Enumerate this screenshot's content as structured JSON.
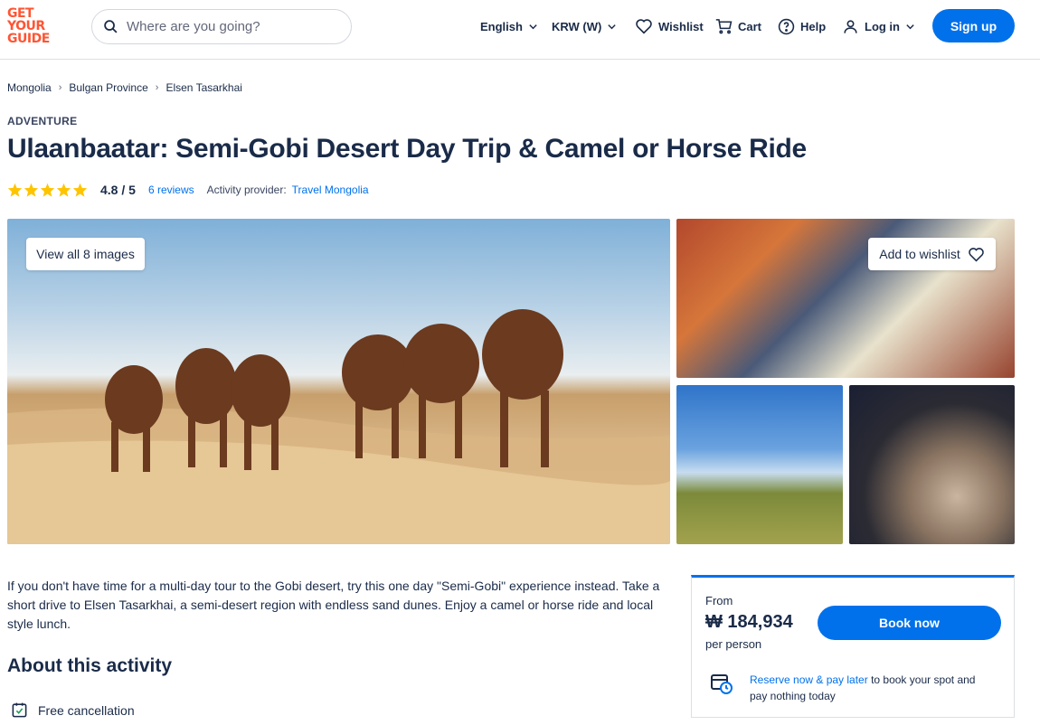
{
  "header": {
    "logo_lines": [
      "GET",
      "YOUR",
      "GUIDE"
    ],
    "search_placeholder": "Where are you going?",
    "language": "English",
    "currency": "KRW (W)",
    "wishlist": "Wishlist",
    "cart": "Cart",
    "help": "Help",
    "login": "Log in",
    "signup": "Sign up"
  },
  "breadcrumb": [
    "Mongolia",
    "Bulgan Province",
    "Elsen Tasarkhai"
  ],
  "activity": {
    "category": "ADVENTURE",
    "title": "Ulaanbaatar: Semi-Gobi Desert Day Trip & Camel or Horse Ride",
    "rating": "4.8",
    "rating_max": "/ 5",
    "reviews": "6 reviews",
    "provider_label": "Activity provider:",
    "provider": "Travel Mongolia"
  },
  "gallery": {
    "view_all": "View all 8 images",
    "add_to_wishlist": "Add to wishlist"
  },
  "description": "If you don't have time for a multi-day tour to the Gobi desert, try this one day \"Semi-Gobi\" experience instead. Take a short drive to Elsen Tasarkhai, a semi-desert region with endless sand dunes. Enjoy a camel or horse ride and local style lunch.",
  "about": {
    "heading": "About this activity",
    "items": [
      "Free cancellation"
    ]
  },
  "booking": {
    "from": "From",
    "price": "₩ 184,934",
    "per": "per person",
    "book_now": "Book now",
    "reserve_link": "Reserve now & pay later",
    "reserve_text": " to book your spot and pay nothing today"
  },
  "colors": {
    "brand": "#ff5533",
    "primary": "#0071eb",
    "text": "#1a2b49",
    "star": "#ffc400"
  }
}
